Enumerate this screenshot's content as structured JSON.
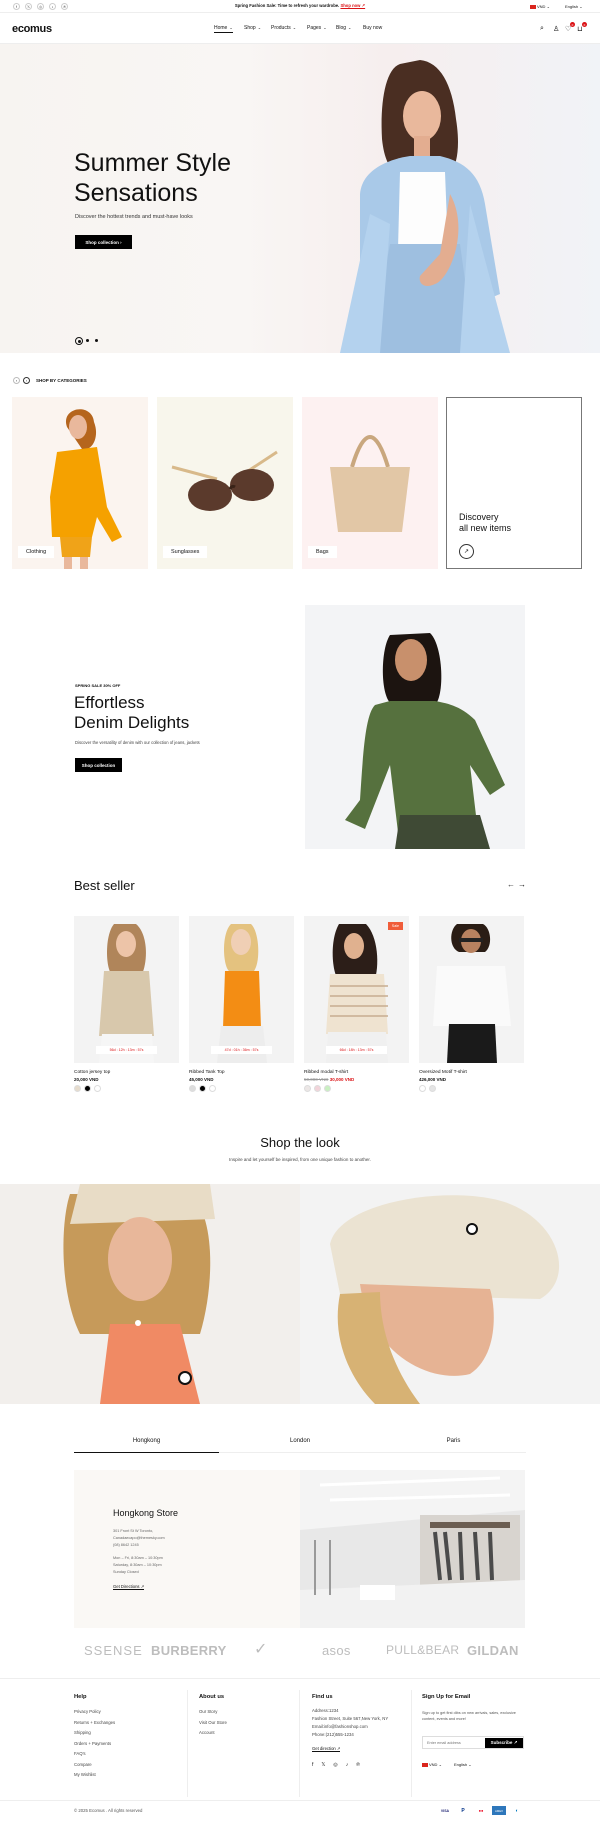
{
  "topbar": {
    "social": [
      "f",
      "𝕏",
      "◎",
      "♪",
      "℗"
    ],
    "promo_text": "Spring Fashion Sale: Time to refresh your wardrobe.",
    "promo_link": "Shop now ↗",
    "currency": "VND",
    "language": "English"
  },
  "header": {
    "logo": "ecomus",
    "nav": [
      "Home",
      "Shop",
      "Products",
      "Pages",
      "Blog",
      "Buy now"
    ],
    "wishlist_count": "0",
    "cart_count": "0"
  },
  "hero": {
    "title_line1": "Summer Style",
    "title_line2": "Sensations",
    "subtitle": "Discover the hottest trends and must-have looks",
    "button": "Shop collection"
  },
  "categories": {
    "heading": "SHOP BY CATEGORIES",
    "items": [
      "Clothing",
      "Sunglasses",
      "Bags"
    ],
    "discovery_line1": "Discovery",
    "discovery_line2": "all new items"
  },
  "promo_banner": {
    "eyebrow": "SPRING SALE 30% OFF",
    "title_line1": "Effortless",
    "title_line2": "Denim Delights",
    "desc": "Discover the versatility of denim with our collection of jeans, jackets",
    "button": "Shop collection"
  },
  "bestseller": {
    "heading": "Best seller",
    "products": [
      {
        "name": "Cotton jersey top",
        "price": "20,000 VND",
        "timer": "56d : 12h : 13m : 57s",
        "old_price": "",
        "sale": ""
      },
      {
        "name": "Ribbed Tank Top",
        "price": "45,000 VND",
        "timer": "47d : 01h : 36m : 57s",
        "old_price": "",
        "sale": ""
      },
      {
        "name": "Ribbed modal T-shirt",
        "price": "30,000 VND",
        "timer": "66d : 18h : 13m : 57s",
        "old_price": "50,000 VND",
        "sale": "Sale"
      },
      {
        "name": "Oversized Motif T-shirt",
        "price": "426,000 VND",
        "timer": "",
        "old_price": "",
        "sale": ""
      }
    ]
  },
  "shop_look": {
    "heading": "Shop the look",
    "subtitle": "Inspire and let yourself be inspired, from one unique fashion to another."
  },
  "stores": {
    "tabs": [
      "Hongkong",
      "London",
      "Paris"
    ],
    "store_name": "Hongkong Store",
    "address1": "301 Front St W Toronto,",
    "email": "Canadaecapo@themesky.com",
    "phone": "(08) 8642 1245",
    "hours1": "Mon – Fri, 8:30am – 10:30pm",
    "hours2": "Saturday, 8:30am – 10:30pm",
    "hours3": "Sunday Closed",
    "directions": "Get Directions ↗"
  },
  "brands": [
    "SSENSE",
    "BURBERRY",
    "✓",
    "asos",
    "PULL&BEAR",
    "GILDAN"
  ],
  "footer": {
    "help_heading": "Help",
    "help_links": [
      "Privacy Policy",
      "Returns + Exchanges",
      "Shipping",
      "Orders + Payments",
      "FAQ's",
      "Compare",
      "My Wishlist"
    ],
    "about_heading": "About us",
    "about_links": [
      "Our Story",
      "Visit Our Store",
      "Account"
    ],
    "find_heading": "Find us",
    "find_lines": [
      "Address:1234",
      "Fashion Street, Suite 567,New York, NY",
      "Email:info@fashionshop.com",
      "Phone:(212)555-1234"
    ],
    "find_directions": "Get direction ↗",
    "signup_heading": "Sign Up for Email",
    "signup_text": "Sign up to get first dibs on new arrivals, sales, exclusive content, events and more!",
    "email_placeholder": "Enter email address",
    "subscribe": "Subscribe ↗",
    "currency": "VND",
    "language": "English",
    "copyright": "© 2025 Ecomus . All rights reserved",
    "payments": [
      "VISA",
      "P",
      "●●",
      "AMEX",
      "◐"
    ]
  }
}
